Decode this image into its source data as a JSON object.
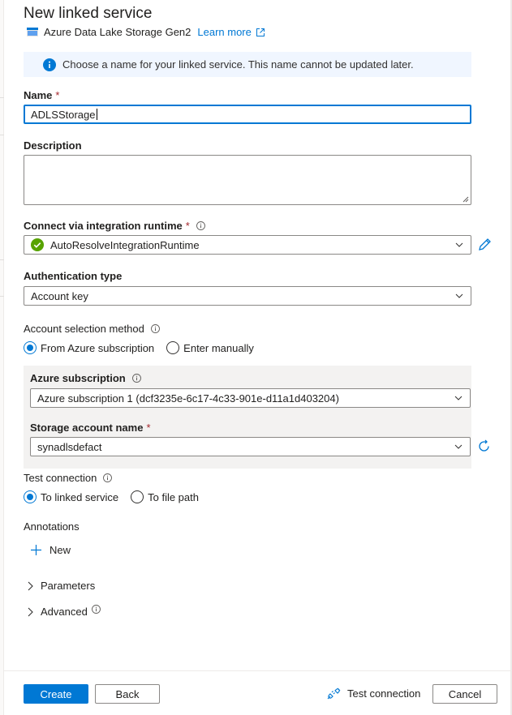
{
  "header": {
    "title": "New linked service",
    "service_type": "Azure Data Lake Storage Gen2",
    "learn_more": "Learn more"
  },
  "info_message": "Choose a name for your linked service. This name cannot be updated later.",
  "fields": {
    "name": {
      "label": "Name",
      "required_mark": "*",
      "value": "ADLSStorage"
    },
    "description": {
      "label": "Description",
      "value": ""
    },
    "integration_runtime": {
      "label": "Connect via integration runtime",
      "required_mark": "*",
      "value": "AutoResolveIntegrationRuntime"
    },
    "authentication_type": {
      "label": "Authentication type",
      "value": "Account key"
    },
    "account_selection": {
      "label": "Account selection method",
      "options": [
        "From Azure subscription",
        "Enter manually"
      ],
      "selected": "From Azure subscription"
    },
    "azure_subscription": {
      "label": "Azure subscription",
      "value": "Azure subscription 1 (dcf3235e-6c17-4c33-901e-d11a1d403204)"
    },
    "storage_account": {
      "label": "Storage account name",
      "required_mark": "*",
      "value": "synadlsdefact"
    },
    "test_connection": {
      "label": "Test connection",
      "options": [
        "To linked service",
        "To file path"
      ],
      "selected": "To linked service"
    }
  },
  "annotations": {
    "label": "Annotations",
    "new_label": "New"
  },
  "sections": {
    "parameters": "Parameters",
    "advanced": "Advanced"
  },
  "footer": {
    "create": "Create",
    "back": "Back",
    "test_connection": "Test connection",
    "cancel": "Cancel"
  },
  "colors": {
    "accent": "#0078d4",
    "success": "#57a300",
    "required": "#a4262c",
    "info_bg": "#f0f6ff"
  }
}
